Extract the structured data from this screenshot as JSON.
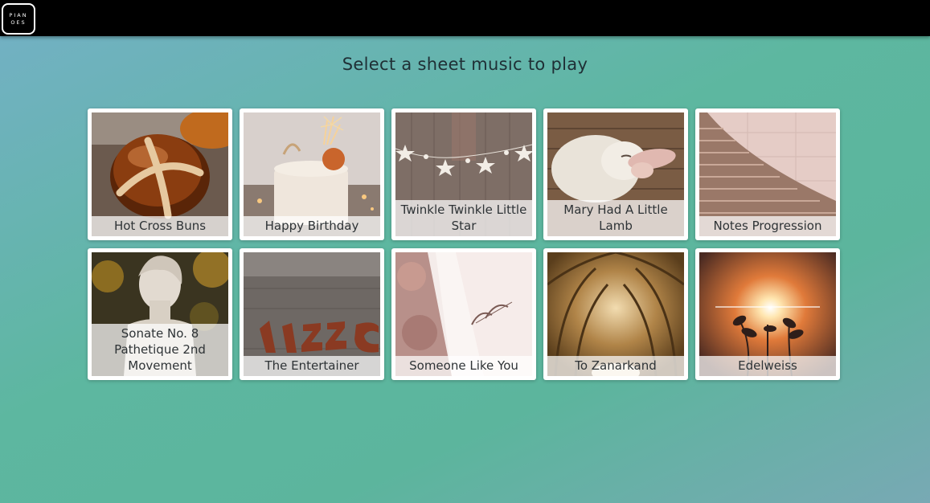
{
  "navbar": {
    "logo_text": "PIANOES"
  },
  "page": {
    "heading": "Select a sheet music to play"
  },
  "songs": [
    {
      "title": "Hot Cross Buns",
      "image": "hot-cross-bun-photo"
    },
    {
      "title": "Happy Birthday",
      "image": "birthday-cake-photo"
    },
    {
      "title": "Twinkle Twinkle Little Star",
      "image": "star-garland-photo"
    },
    {
      "title": "Mary Had A Little Lamb",
      "image": "lamb-photo"
    },
    {
      "title": "Notes Progression",
      "image": "staircase-photo"
    },
    {
      "title": "Sonate No. 8 Pathetique 2nd Movement",
      "image": "beethoven-bust-photo"
    },
    {
      "title": "The Entertainer",
      "image": "jazz-sign-photo"
    },
    {
      "title": "Someone Like You",
      "image": "thank-you-card-photo"
    },
    {
      "title": "To Zanarkand",
      "image": "tree-tunnel-photo"
    },
    {
      "title": "Edelweiss",
      "image": "sunlit-flowers-photo"
    }
  ]
}
